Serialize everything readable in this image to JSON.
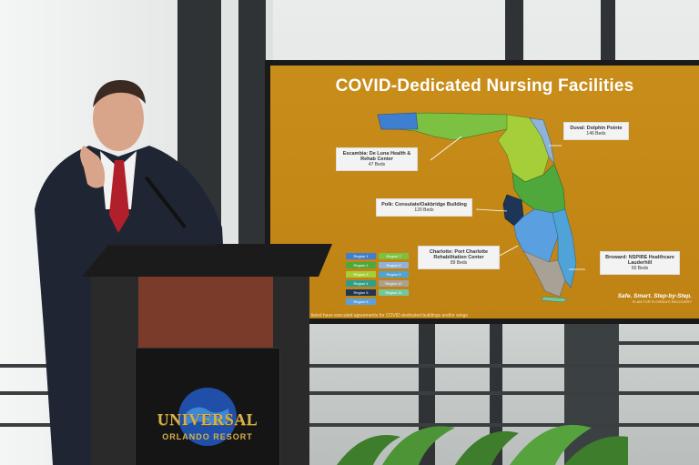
{
  "slide": {
    "title": "COVID-Dedicated Nursing Facilities",
    "callouts": [
      {
        "title": "Duval: Dolphin Pointe",
        "sub": "146 Beds"
      },
      {
        "title": "Escambia: De Luna Health & Rehab Center",
        "sub": "47 Beds"
      },
      {
        "title": "Polk: Consulate/Oakbridge Building",
        "sub": "120 Beds"
      },
      {
        "title": "Charlotte: Port Charlotte Rehabilitation Center",
        "sub": "89 Beds"
      },
      {
        "title": "Broward: NSPIRE Healthcare Lauderhill",
        "sub": "60 Beds"
      }
    ],
    "legend": [
      {
        "label": "Region 1",
        "color": "#3f7fd1"
      },
      {
        "label": "Region 7",
        "color": "#7cc142"
      },
      {
        "label": "Region 2",
        "color": "#4ea83c"
      },
      {
        "label": "Region 8",
        "color": "#8fb3d9"
      },
      {
        "label": "Region 3",
        "color": "#a6ce39"
      },
      {
        "label": "Region 9",
        "color": "#4fa3d6"
      },
      {
        "label": "Region 4",
        "color": "#2f9e8f"
      },
      {
        "label": "Region 10",
        "color": "#a8a195"
      },
      {
        "label": "Region 5",
        "color": "#1d3557"
      },
      {
        "label": "Region 11",
        "color": "#74c69d"
      },
      {
        "label": "Region 6",
        "color": "#5aa0e0"
      }
    ],
    "footnote": "Facilities listed have executed agreements for COVID-dedicated buildings and/or wings",
    "tagline": "Safe. Smart. Step-by-Step.",
    "tagline_sub": "PLAN FOR FLORIDA'S RECOVERY"
  },
  "podium_logo": {
    "line1": "UNIVERSAL",
    "line2": "ORLANDO RESORT"
  },
  "colors": {
    "slide_bg": "#c98d1a",
    "map_green": "#7cc142",
    "map_blue": "#5aa0e0",
    "logo_gold": "#d7b24a"
  }
}
